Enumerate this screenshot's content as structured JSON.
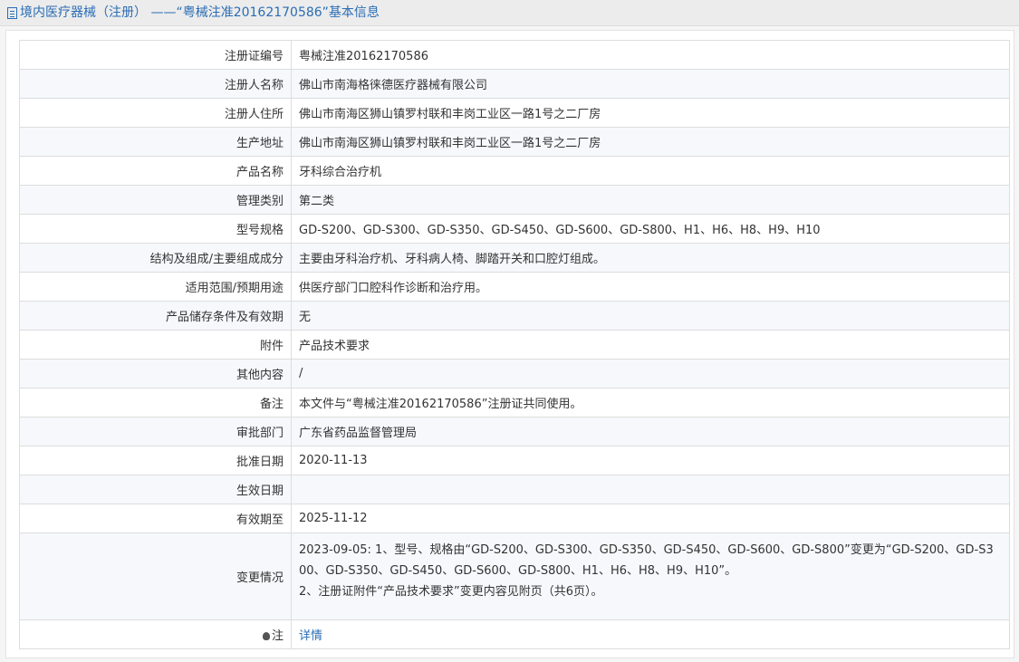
{
  "page": {
    "title": "境内医疗器械（注册） ——“粤械注准20162170586”基本信息"
  },
  "rows": [
    {
      "label": "注册证编号",
      "value": "粤械注准20162170586"
    },
    {
      "label": "注册人名称",
      "value": "佛山市南海格徕德医疗器械有限公司"
    },
    {
      "label": "注册人住所",
      "value": "佛山市南海区狮山镇罗村联和丰岗工业区一路1号之二厂房"
    },
    {
      "label": "生产地址",
      "value": "佛山市南海区狮山镇罗村联和丰岗工业区一路1号之二厂房"
    },
    {
      "label": "产品名称",
      "value": "牙科综合治疗机"
    },
    {
      "label": "管理类别",
      "value": "第二类"
    },
    {
      "label": "型号规格",
      "value": "GD-S200、GD-S300、GD-S350、GD-S450、GD-S600、GD-S800、H1、H6、H8、H9、H10"
    },
    {
      "label": "结构及组成/主要组成成分",
      "value": "主要由牙科治疗机、牙科病人椅、脚踏开关和口腔灯组成。"
    },
    {
      "label": "适用范围/预期用途",
      "value": "供医疗部门口腔科作诊断和治疗用。"
    },
    {
      "label": "产品储存条件及有效期",
      "value": "无"
    },
    {
      "label": "附件",
      "value": "产品技术要求"
    },
    {
      "label": "其他内容",
      "value": "/"
    },
    {
      "label": "备注",
      "value": "本文件与“粤械注准20162170586”注册证共同使用。"
    },
    {
      "label": "审批部门",
      "value": "广东省药品监督管理局"
    },
    {
      "label": "批准日期",
      "value": "2020-11-13"
    },
    {
      "label": "生效日期",
      "value": ""
    },
    {
      "label": "有效期至",
      "value": "2025-11-12"
    }
  ],
  "change": {
    "label": "变更情况",
    "line1": "2023-09-05: 1、型号、规格由“GD-S200、GD-S300、GD-S350、GD-S450、GD-S600、GD-S800”变更为“GD-S200、GD-S3",
    "line2": "00、GD-S350、GD-S450、GD-S600、GD-S800、H1、H6、H8、H9、H10”。",
    "line3": "2、注册证附件“产品技术要求”变更内容见附页（共6页）。"
  },
  "note": {
    "label": "注",
    "link": "详情"
  }
}
